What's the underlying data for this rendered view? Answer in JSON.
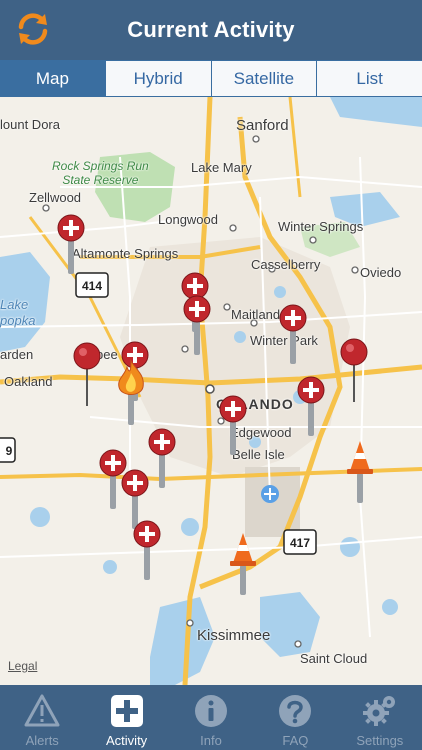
{
  "header": {
    "title": "Current Activity",
    "refresh_icon": "refresh-icon"
  },
  "tabs": [
    {
      "label": "Map",
      "active": true
    },
    {
      "label": "Hybrid",
      "active": false
    },
    {
      "label": "Satellite",
      "active": false
    },
    {
      "label": "List",
      "active": false
    }
  ],
  "map": {
    "labels": {
      "sanford": "Sanford",
      "mount_dora": "lount Dora",
      "rock_springs": "Rock Springs Run",
      "state_reserve": "State Reserve",
      "lake_mary": "Lake Mary",
      "zellwood": "Zellwood",
      "longwood": "Longwood",
      "winter_springs": "Winter Springs",
      "altamonte": "Altamonte Springs",
      "casselberry": "Casselberry",
      "oviedo": "Oviedo",
      "lake": "Lake",
      "apopka_lake": "popka",
      "maitland": "Maitland",
      "winter_park": "Winter Park",
      "garden": "arden",
      "apopka_town": "pee",
      "oakland": "Oakland",
      "orlando": "ORLANDO",
      "edgewood": "Edgewood",
      "belle_isle": "Belle Isle",
      "kissimmee": "Kissimmee",
      "saint_cloud": "Saint Cloud"
    },
    "shields": {
      "sr414": "414",
      "sr417": "417",
      "left_edge": "9"
    },
    "legal": "Legal"
  },
  "tabbar": [
    {
      "label": "Alerts",
      "icon": "alert-triangle-icon",
      "active": false
    },
    {
      "label": "Activity",
      "icon": "plus-square-icon",
      "active": true
    },
    {
      "label": "Info",
      "icon": "info-icon",
      "active": false
    },
    {
      "label": "FAQ",
      "icon": "question-icon",
      "active": false
    },
    {
      "label": "Settings",
      "icon": "gear-icon",
      "active": false
    }
  ]
}
